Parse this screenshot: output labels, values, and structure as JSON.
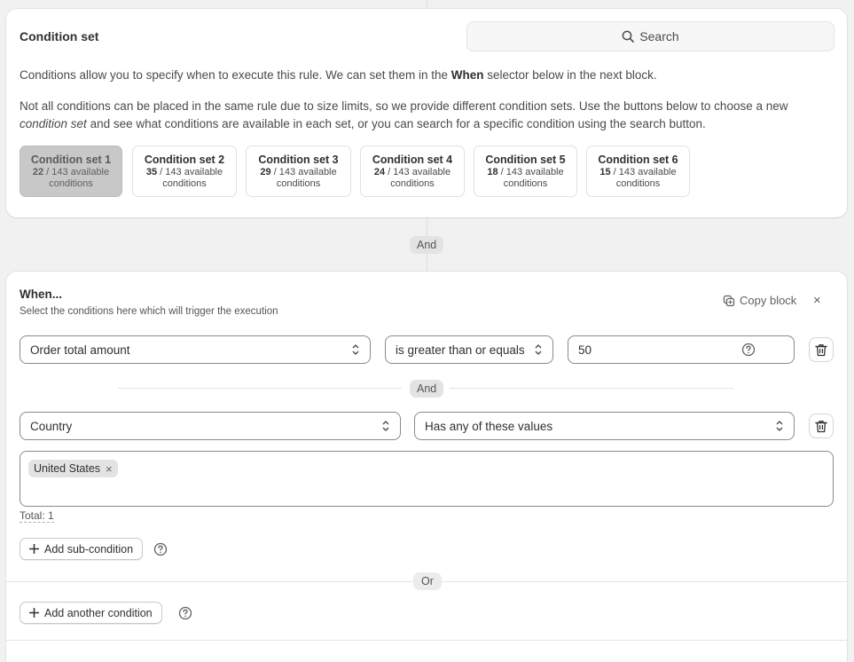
{
  "condition_set": {
    "title": "Condition set",
    "search_label": "Search",
    "desc1_a": "Conditions allow you to specify when to execute this rule. We can set them in the ",
    "desc1_b": "When",
    "desc1_c": " selector below in the next block.",
    "desc2_a": "Not all conditions can be placed in the same rule due to size limits, so we provide different condition sets. Use the buttons below to choose a new ",
    "desc2_b": "condition set",
    "desc2_c": " and see what conditions are available in each set, or you can search for a specific condition using the search button.",
    "sets": [
      {
        "name": "Condition set 1",
        "count": "22",
        "suffix": " / 143 available",
        "unit": "conditions"
      },
      {
        "name": "Condition set 2",
        "count": "35",
        "suffix": " / 143 available",
        "unit": "conditions"
      },
      {
        "name": "Condition set 3",
        "count": "29",
        "suffix": " / 143 available",
        "unit": "conditions"
      },
      {
        "name": "Condition set 4",
        "count": "24",
        "suffix": " / 143 available",
        "unit": "conditions"
      },
      {
        "name": "Condition set 5",
        "count": "18",
        "suffix": " / 143 available",
        "unit": "conditions"
      },
      {
        "name": "Condition set 6",
        "count": "15",
        "suffix": " / 143 available",
        "unit": "conditions"
      }
    ]
  },
  "connector_and": "And",
  "when": {
    "title": "When...",
    "subtitle": "Select the conditions here which will trigger the execution",
    "copy_label": "Copy block",
    "close_label": "×",
    "row1": {
      "field": "Order total amount",
      "operator": "is greater than or equals",
      "value": "50"
    },
    "inner_and": "And",
    "row2": {
      "field": "Country",
      "operator": "Has any of these values"
    },
    "tags": [
      {
        "label": "United States",
        "remove": "×"
      }
    ],
    "total": "Total: 1",
    "add_sub_label": "Add sub-condition",
    "or_label": "Or",
    "add_another_label": "Add another condition"
  },
  "icons": {
    "search": "search-icon",
    "copy": "copy-icon",
    "trash": "trash-icon",
    "chevron": "chevron-updown-icon",
    "help": "help-circle-icon",
    "plus": "plus-icon"
  }
}
